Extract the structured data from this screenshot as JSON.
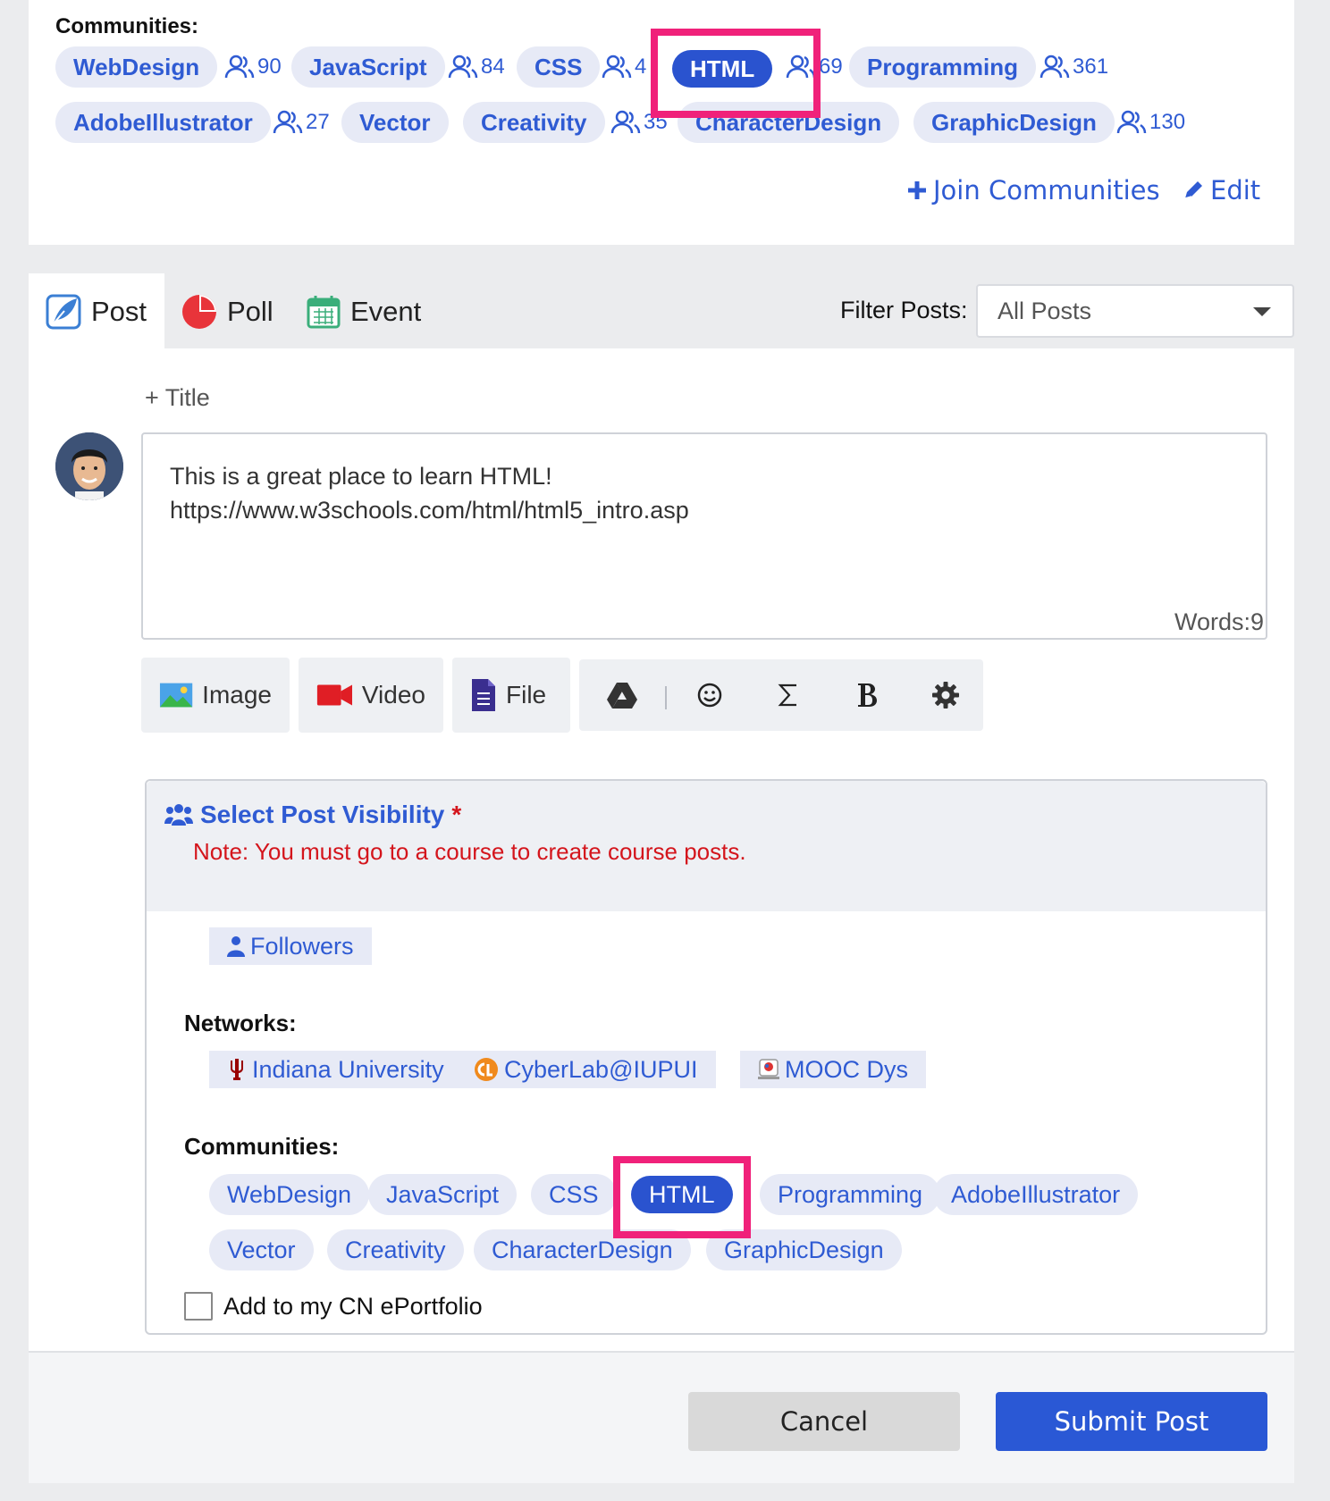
{
  "top_communities": {
    "label": "Communities:",
    "tags": [
      {
        "name": "WebDesign",
        "members": "90"
      },
      {
        "name": "JavaScript",
        "members": "84"
      },
      {
        "name": "CSS",
        "members": "4"
      },
      {
        "name": "HTML",
        "members": "69"
      },
      {
        "name": "Programming",
        "members": "361"
      },
      {
        "name": "AdobeIllustrator",
        "members": "27"
      },
      {
        "name": "Vector",
        "members": ""
      },
      {
        "name": "Creativity",
        "members": "35"
      },
      {
        "name": "CharacterDesign",
        "members": ""
      },
      {
        "name": "GraphicDesign",
        "members": "130"
      }
    ],
    "join_label": "Join Communities",
    "edit_label": "Edit"
  },
  "tabs": {
    "post": "Post",
    "poll": "Poll",
    "event": "Event"
  },
  "filter": {
    "label": "Filter Posts:",
    "value": "All Posts"
  },
  "composer": {
    "title_placeholder": "+ Title",
    "text_line1": "This is a great place to learn HTML!",
    "text_line2": "https://www.w3schools.com/html/html5_intro.asp",
    "word_count": "Words:9",
    "tools": {
      "image": "Image",
      "video": "Video",
      "file": "File"
    }
  },
  "visibility": {
    "title": "Select Post Visibility",
    "required_mark": "*",
    "note": "Note: You must go to a course to create course posts.",
    "followers": "Followers",
    "networks_label": "Networks:",
    "networks": [
      "Indiana University",
      "CyberLab@IUPUI",
      "MOOC Dys"
    ],
    "communities_label": "Communities:",
    "communities": [
      "WebDesign",
      "JavaScript",
      "CSS",
      "HTML",
      "Programming",
      "AdobeIllustrator",
      "Vector",
      "Creativity",
      "CharacterDesign",
      "GraphicDesign"
    ],
    "portfolio_label": "Add to my CN ePortfolio"
  },
  "footer": {
    "cancel": "Cancel",
    "submit": "Submit Post"
  },
  "colors": {
    "accent": "#2a53cf",
    "tag_bg": "#e7eaf6",
    "highlight": "#f0217a",
    "error": "#d4151c"
  }
}
